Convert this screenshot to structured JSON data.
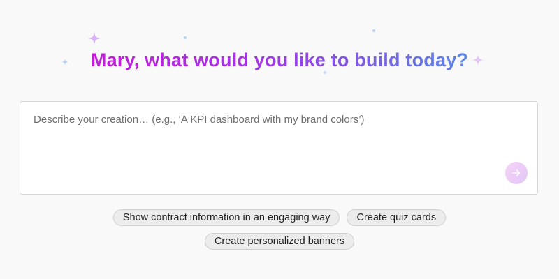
{
  "greeting": {
    "headline": "Mary, what would you like to build today?"
  },
  "prompt": {
    "placeholder": "Describe your creation… (e.g., ‘A KPI dashboard with my brand colors’)",
    "value": "",
    "send_icon": "arrow-right-icon"
  },
  "suggestions": [
    {
      "label": "Show contract information in an engaging way"
    },
    {
      "label": "Create quiz cards"
    },
    {
      "label": "Create personalized banners"
    }
  ],
  "colors": {
    "headline_gradient_start": "#c21ed6",
    "headline_gradient_end": "#5b86e8",
    "sparkle_purple": "#d8b4f5",
    "sparkle_blue": "#b9d3f5",
    "send_button_bg": "#efcdf6",
    "chip_bg": "#ececec",
    "page_bg": "#f9f9f9"
  },
  "decorations": {
    "icons": [
      "sparkle-icon",
      "sparkle-icon",
      "sparkle-icon",
      "dot-icon",
      "dot-icon",
      "dot-icon"
    ]
  }
}
